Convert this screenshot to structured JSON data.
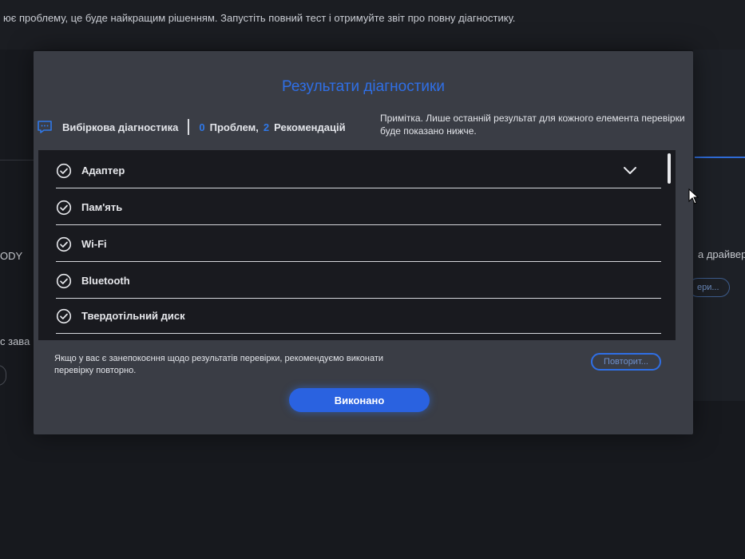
{
  "background": {
    "top_text": "ює проблему, це буде найкращим рішенням. Запустіть повний тест і отримуйте звіт про повну діагностику.",
    "left_text_1": "ODY",
    "left_text_2": "с зава",
    "right_text": "а драйвер",
    "right_button": "ери..."
  },
  "dialog": {
    "title": "Результати діагностики",
    "summary": {
      "icon": "chat-icon",
      "label": "Вибіркова діагностика",
      "problems_count": "0",
      "problems_label": "Проблем,",
      "recommendations_count": "2",
      "recommendations_label": "Рекомендацій"
    },
    "note": "Примітка. Лише останній результат для кожного елемента перевірки буде показано нижче.",
    "items": [
      {
        "label": "Адаптер",
        "icon": "check-circle-icon"
      },
      {
        "label": "Пам'ять",
        "icon": "check-circle-icon"
      },
      {
        "label": "Wi-Fi",
        "icon": "check-circle-icon"
      },
      {
        "label": "Bluetooth",
        "icon": "check-circle-icon"
      },
      {
        "label": "Твердотільний диск",
        "icon": "check-circle-icon"
      }
    ],
    "footer_text": "Якщо у вас є занепокоєння щодо результатів перевірки, рекомендуємо виконати перевірку повторно.",
    "retry_label": "Повторит...",
    "done_label": "Виконано"
  },
  "colors": {
    "accent": "#2f6fe6",
    "dialog_bg": "#3a3d45",
    "list_bg": "#191a1f"
  }
}
